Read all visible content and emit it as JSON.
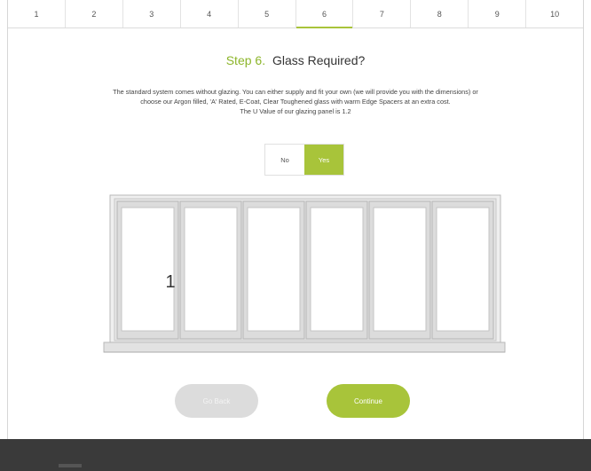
{
  "steps": [
    "1",
    "2",
    "3",
    "4",
    "5",
    "6",
    "7",
    "8",
    "9",
    "10"
  ],
  "active_step": "6",
  "heading": {
    "step_label": "Step 6.",
    "title": "Glass Required?"
  },
  "description": {
    "line1": "The standard system comes without glazing. You can either supply and fit your own (we will provide you with the dimensions) or",
    "line2": "choose our Argon filled, 'A' Rated, E-Coat, Clear Toughened glass with warm Edge Spacers at an extra cost.",
    "line3": "The U Value of our glazing panel is 1.2"
  },
  "glass_toggle": {
    "options": [
      "No",
      "Yes"
    ],
    "selected": "Yes"
  },
  "door_diagram": {
    "panel_count": 6,
    "handle_panel": 1,
    "handle_label": "1"
  },
  "buttons": {
    "back": "Go Back",
    "continue": "Continue"
  },
  "colors": {
    "accent": "#a8c43a",
    "heading_accent": "#8cb52a",
    "footer": "#3a3a3a",
    "disabled_button": "#dcdcdc"
  }
}
